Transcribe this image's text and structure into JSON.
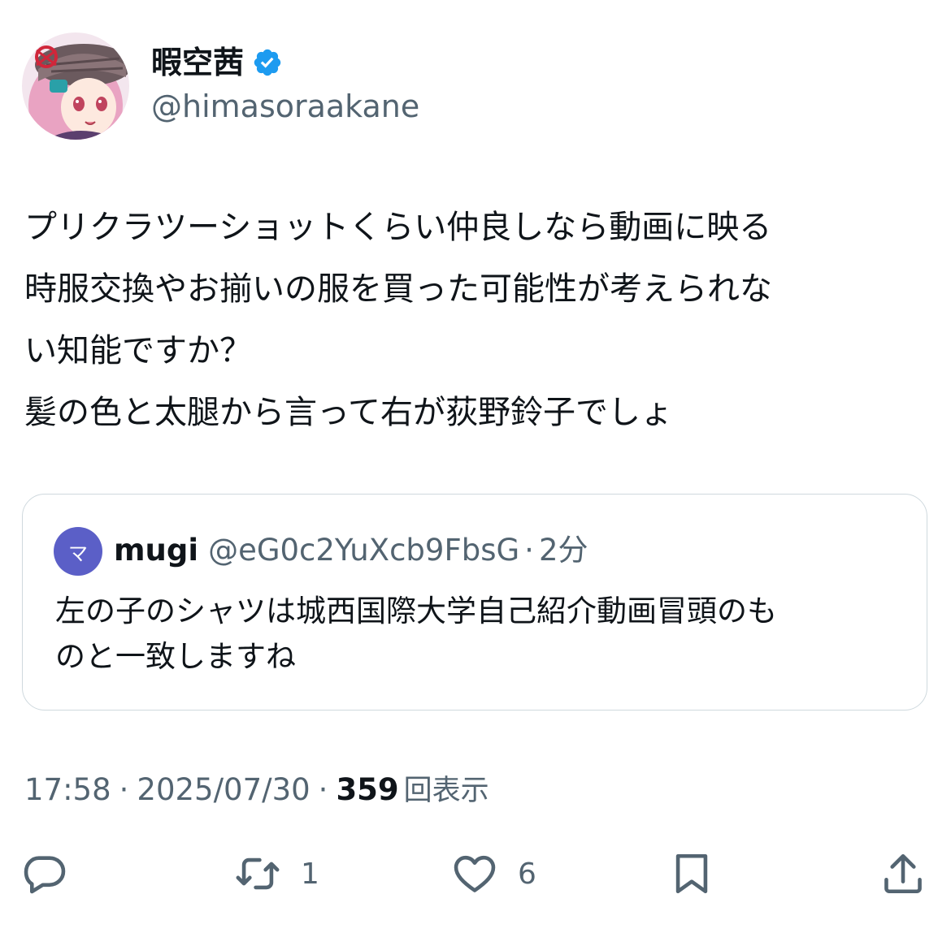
{
  "author": {
    "name": "暇空茜",
    "handle": "@himasoraakane",
    "verified_icon": "verified-badge-icon",
    "avatar_icon": "anime-avatar"
  },
  "tweet": {
    "lines": [
      "プリクラツーショットくらい仲良しなら動画に映る",
      "時服交換やお揃いの服を買った可能性が考えられな",
      "い知能ですか？",
      "髪の色と太腿から言って右が荻野鈴子でしょ"
    ]
  },
  "quote": {
    "avatar_letter": "マ",
    "name": "mugi",
    "handle": "@eG0c2YuXcb9FbsG",
    "dot": "·",
    "time": "2分",
    "lines": [
      "左の子のシャツは城西国際大学自己紹介動画冒頭のも",
      "のと一致しますね"
    ]
  },
  "meta": {
    "time": "17:58",
    "sep1": "·",
    "date": "2025/07/30",
    "sep2": "·",
    "views_count": "359",
    "views_label": "回表示"
  },
  "actions": {
    "reply": {
      "icon": "reply-icon"
    },
    "retweet": {
      "icon": "retweet-icon",
      "count": "1"
    },
    "like": {
      "icon": "heart-icon",
      "count": "6"
    },
    "bookmark": {
      "icon": "bookmark-icon"
    },
    "share": {
      "icon": "share-icon"
    }
  },
  "colors": {
    "text": "#0f1419",
    "secondary": "#536471",
    "border": "#cfd9de",
    "verified": "#1d9bf0",
    "quote_avatar": "#5b5fc7"
  }
}
